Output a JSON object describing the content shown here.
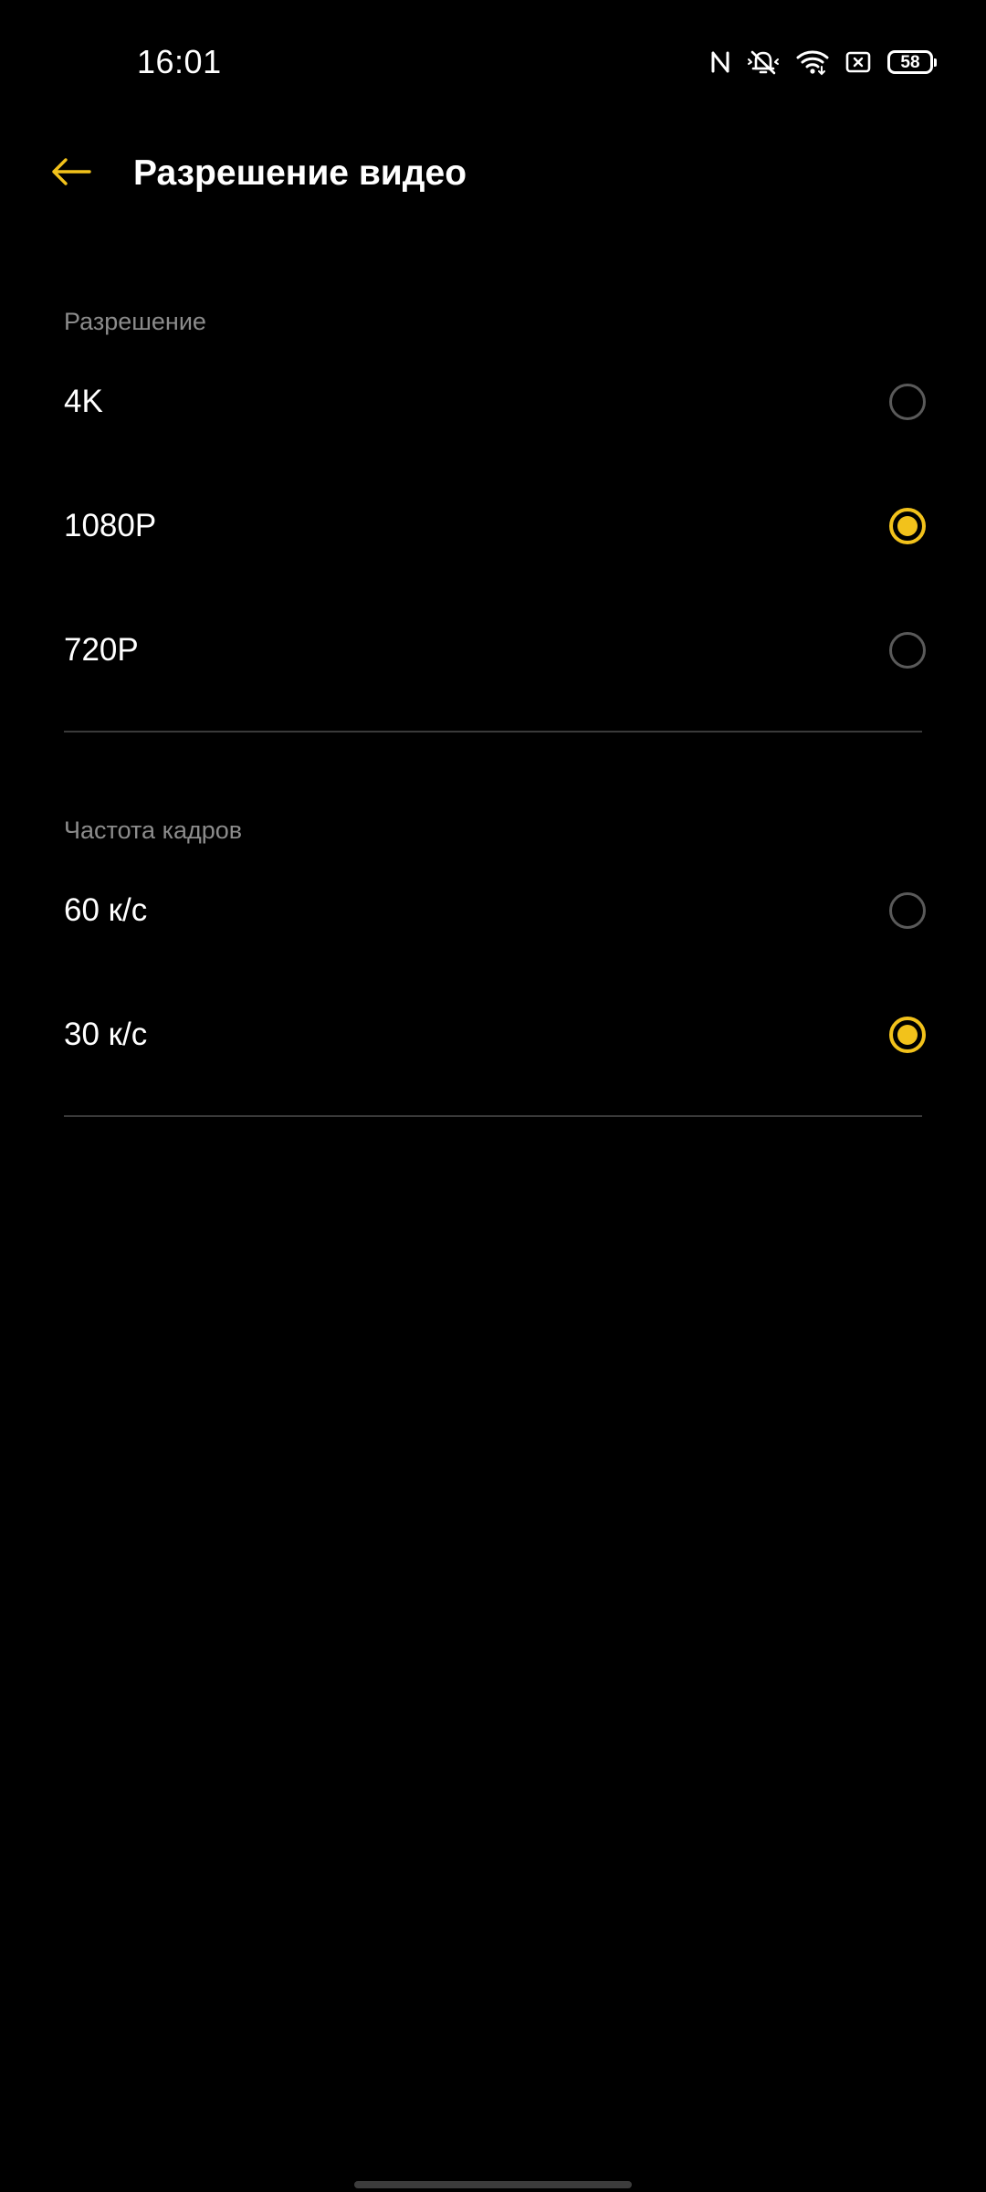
{
  "status_bar": {
    "time": "16:01",
    "battery_level": "58",
    "icons": [
      "nfc-icon",
      "bell-off-icon",
      "wifi-icon",
      "sim-off-icon",
      "battery-icon"
    ]
  },
  "header": {
    "title": "Разрешение видео",
    "back_icon": "arrow-left-icon"
  },
  "resolution_section": {
    "label": "Разрешение",
    "options": [
      {
        "label": "4K",
        "selected": false
      },
      {
        "label": "1080P",
        "selected": true
      },
      {
        "label": "720P",
        "selected": false
      }
    ]
  },
  "framerate_section": {
    "label": "Частота кадров",
    "options": [
      {
        "label": "60 к/с",
        "selected": false
      },
      {
        "label": "30 к/с",
        "selected": true
      }
    ]
  },
  "colors": {
    "accent": "#f2c21b",
    "background": "#000000",
    "secondary_text": "#8c8c8c"
  }
}
